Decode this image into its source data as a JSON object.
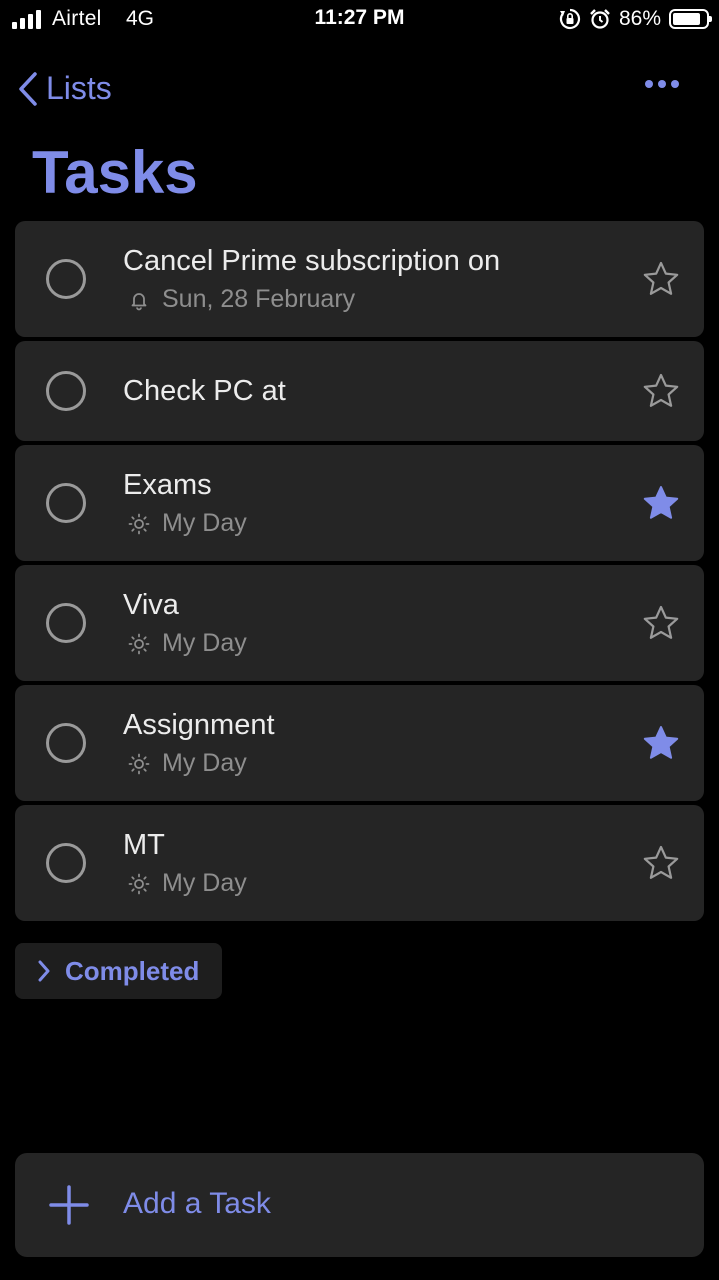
{
  "status_bar": {
    "carrier": "Airtel",
    "network": "4G",
    "time": "11:27 PM",
    "battery_percent_label": "86%",
    "battery_level": 0.86,
    "signal_bars": 4,
    "icons": [
      "signal-icon",
      "orientation-lock-icon",
      "alarm-icon",
      "battery-icon"
    ]
  },
  "nav": {
    "back_label": "Lists",
    "back_icon": "chevron-left-icon",
    "more_icon": "more-horizontal-icon"
  },
  "page": {
    "title": "Tasks"
  },
  "colors": {
    "accent": "#7f8ce8",
    "background": "#000000",
    "card": "#252525",
    "text_primary": "#ececec",
    "text_secondary": "#8e8e8e"
  },
  "tasks": [
    {
      "title": "Cancel Prime subscription on",
      "subtitle": "Sun, 28 February",
      "subtitle_icon": "bell-icon",
      "important": false
    },
    {
      "title": "Check PC at",
      "subtitle": "",
      "subtitle_icon": "",
      "important": false
    },
    {
      "title": "Exams",
      "subtitle": "My Day",
      "subtitle_icon": "sun-icon",
      "important": true
    },
    {
      "title": "Viva",
      "subtitle": "My Day",
      "subtitle_icon": "sun-icon",
      "important": false
    },
    {
      "title": "Assignment",
      "subtitle": "My Day",
      "subtitle_icon": "sun-icon",
      "important": true
    },
    {
      "title": "MT",
      "subtitle": "My Day",
      "subtitle_icon": "sun-icon",
      "important": false
    }
  ],
  "completed": {
    "label": "Completed",
    "icon": "chevron-right-icon"
  },
  "add_task": {
    "label": "Add a Task",
    "icon": "plus-icon"
  }
}
